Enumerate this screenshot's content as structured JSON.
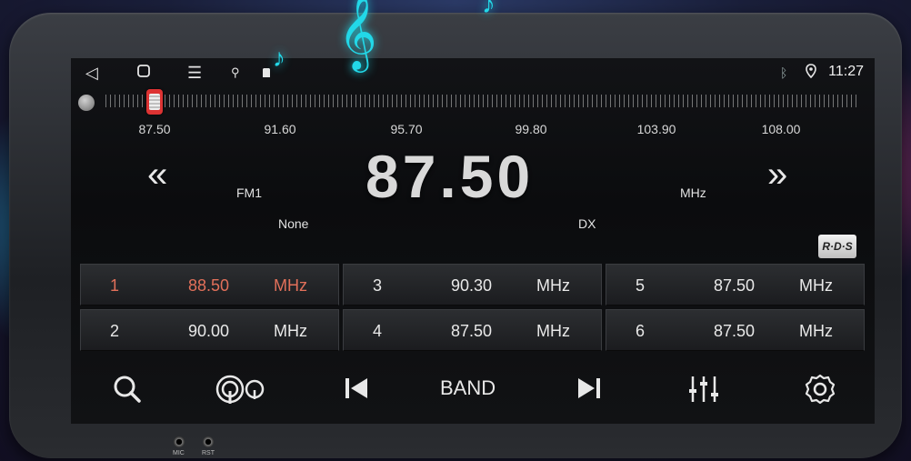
{
  "status_bar": {
    "time": "11:27",
    "left_icons": [
      "back-icon",
      "home-icon",
      "menu-icon",
      "usb-icon",
      "sd-card-icon"
    ],
    "right_icons": [
      "bluetooth-icon",
      "location-icon"
    ]
  },
  "dial": {
    "current_frequency": 87.5,
    "range": [
      87.5,
      108.0
    ],
    "ticks": [
      "87.50",
      "91.60",
      "95.70",
      "99.80",
      "103.90",
      "108.00"
    ]
  },
  "display": {
    "frequency": "87.50",
    "band": "FM1",
    "unit": "MHz",
    "ps_name": "None",
    "mode": "DX",
    "rds_badge": "R·D·S"
  },
  "presets": [
    {
      "num": "1",
      "freq": "88.50",
      "unit": "MHz",
      "active": true
    },
    {
      "num": "2",
      "freq": "90.00",
      "unit": "MHz",
      "active": false
    },
    {
      "num": "3",
      "freq": "90.30",
      "unit": "MHz",
      "active": false
    },
    {
      "num": "4",
      "freq": "87.50",
      "unit": "MHz",
      "active": false
    },
    {
      "num": "5",
      "freq": "87.50",
      "unit": "MHz",
      "active": false
    },
    {
      "num": "6",
      "freq": "87.50",
      "unit": "MHz",
      "active": false
    }
  ],
  "toolbar": {
    "band_label": "BAND",
    "icons": [
      "search-icon",
      "local-distance-icon",
      "previous-icon",
      "next-icon",
      "equalizer-icon",
      "settings-icon"
    ]
  },
  "controls": {
    "seek_back_glyph": "«",
    "seek_forward_glyph": "»"
  },
  "device": {
    "mic_label": "MIC",
    "rst_label": "RST"
  },
  "colors": {
    "active_preset": "#e2705a",
    "note_glow": "#22d8e8",
    "text": "#e8e8e8"
  }
}
